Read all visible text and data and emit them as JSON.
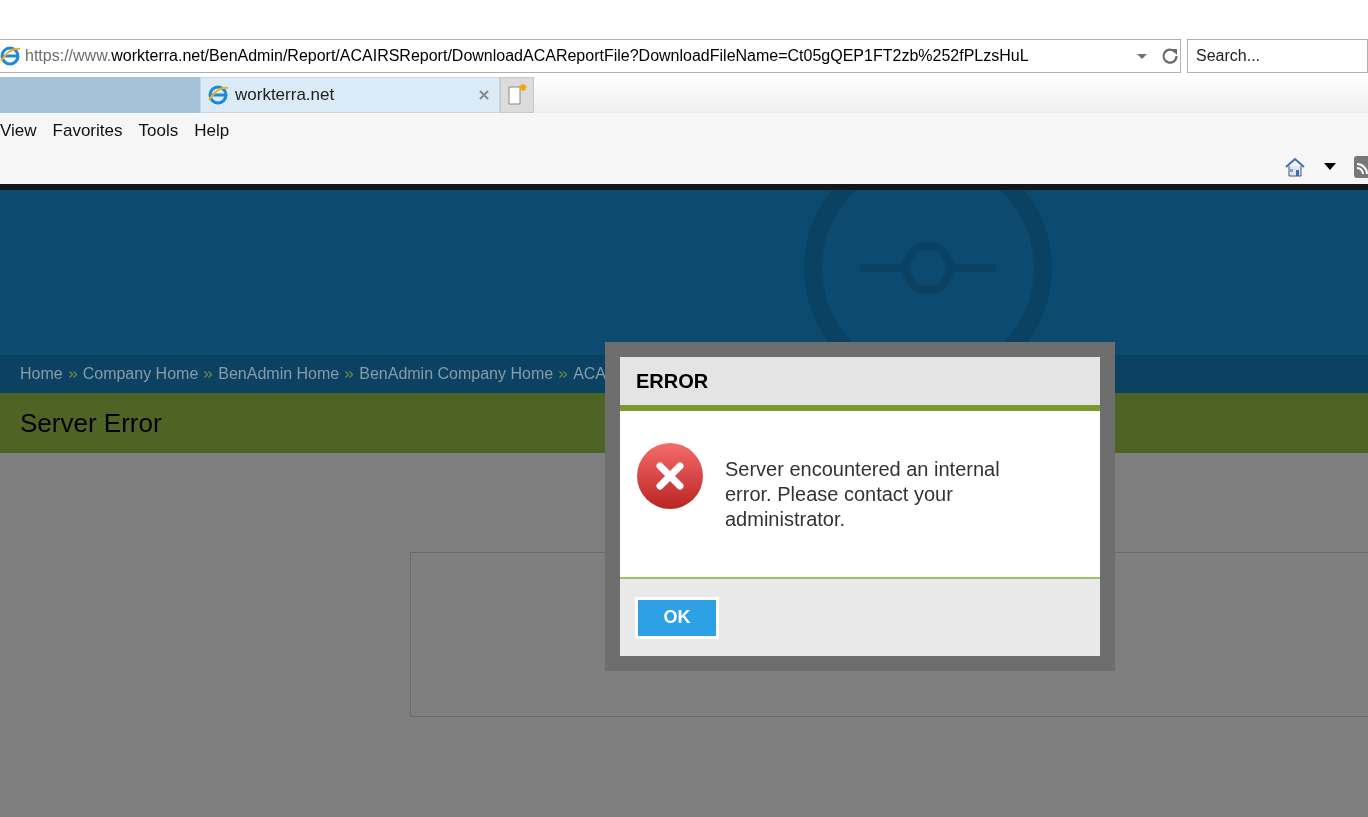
{
  "browser": {
    "address": "https://www.**workterra.net**/BenAdmin/Report/ACAIRSReport/DownloadACAReportFile?DownloadFileName=Ct05gQEP1FT2zb%252fPLzsHuL",
    "search": {
      "placeholder": "Search..."
    },
    "tabs": [
      {
        "label": "workterra.net",
        "selected": true
      }
    ],
    "menu": [
      "View",
      "Favorites",
      "Tools",
      "Help"
    ]
  },
  "page": {
    "breadcrumb": [
      "Home",
      "Company Home",
      "BenAdmin Home",
      "BenAdmin Company Home",
      "ACA"
    ],
    "title": "Server Error"
  },
  "dialog": {
    "title": "ERROR",
    "message": "Server encountered an internal error. Please contact your administrator.",
    "buttons": [
      "OK"
    ]
  }
}
